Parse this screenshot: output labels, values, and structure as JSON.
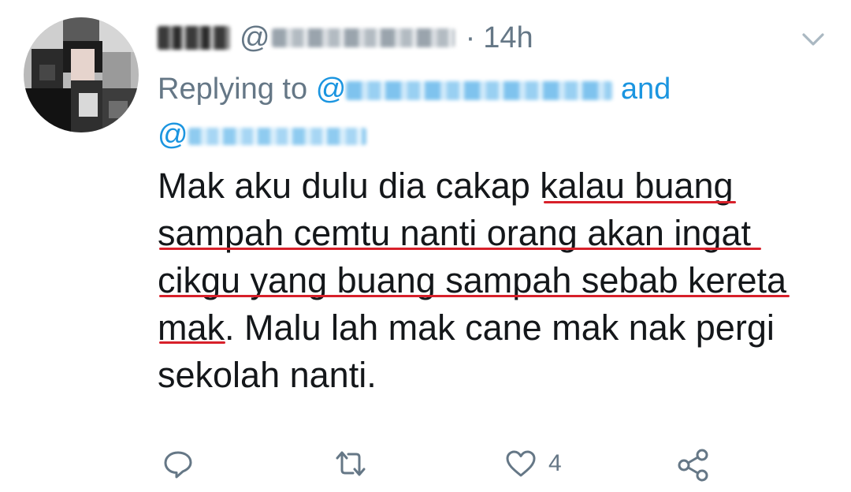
{
  "tweet": {
    "time_separator": "·",
    "timestamp": "14h",
    "at_symbol": "@",
    "replying_prefix": "Replying to",
    "reply_at_1": "@",
    "reply_and": "and",
    "reply_at_2": "@",
    "text": "Mak aku dulu dia cakap kalau buang sampah cemtu nanti orang akan ingat cikgu yang buang sampah sebab kereta mak. Malu lah mak cane mak nak pergi sekolah nanti.",
    "text_lines": [
      "Mak aku dulu dia cakap kalau buang",
      "sampah cemtu nanti orang akan ingat",
      "cikgu yang buang sampah sebab kereta",
      "mak. Malu lah mak cane mak nak pergi",
      "sekolah nanti."
    ],
    "underline_color": "#d8202a"
  },
  "actions": {
    "reply_icon": "reply-icon",
    "retweet_icon": "retweet-icon",
    "like_icon": "heart-icon",
    "like_count": "4",
    "share_icon": "share-icon"
  },
  "colors": {
    "text_primary": "#14171a",
    "text_secondary": "#657786",
    "link": "#1b95e0"
  }
}
